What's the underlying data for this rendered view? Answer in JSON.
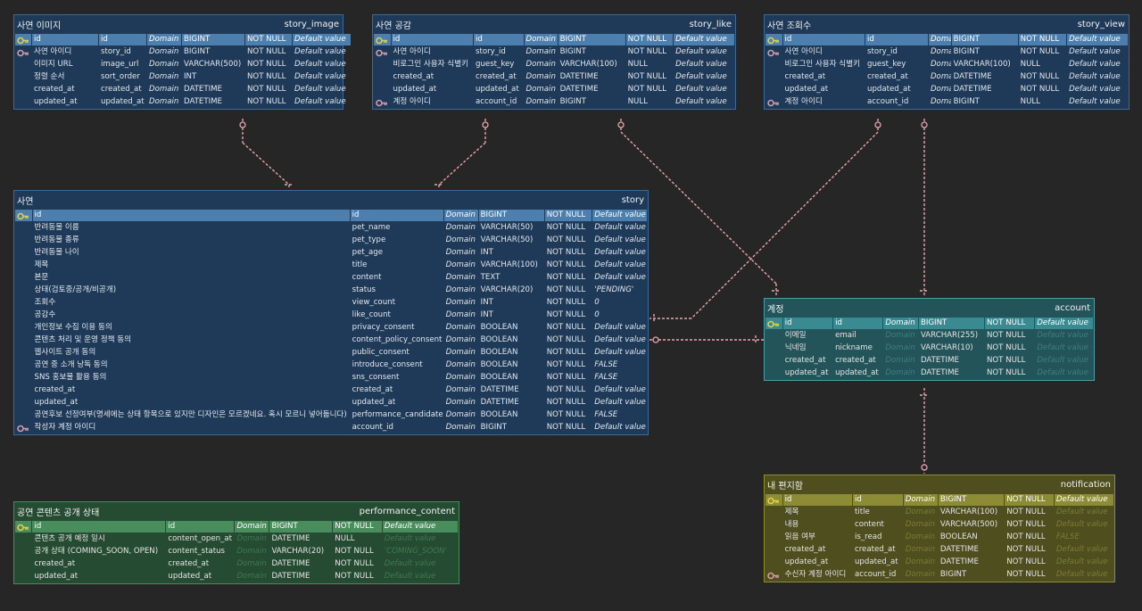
{
  "colors": {
    "background": "#262626",
    "blue_entity": "#1e3a58",
    "blue_header": "#4c7fae",
    "teal_entity": "#22545a",
    "teal_header": "#3a8a91",
    "green_entity": "#254b32",
    "green_header": "#4a8d5c",
    "olive_entity": "#4e4e1e",
    "olive_header": "#8c8c36",
    "relationship_line": "#e7a3ac",
    "primary_key_icon": "#e0d048",
    "foreign_key_icon": "#d49aa6"
  },
  "entities": {
    "story_image": {
      "logical_name": "사연 이미지",
      "physical_name": "story_image",
      "columns": [
        {
          "logical": "id",
          "physical": "id",
          "domain": "Domain",
          "type": "BIGINT",
          "nullable": "NOT NULL",
          "default": "Default value",
          "key": "pk"
        },
        {
          "logical": "사연 아이디",
          "physical": "story_id",
          "domain": "Domain",
          "type": "BIGINT",
          "nullable": "NOT NULL",
          "default": "Default value",
          "key": "fk"
        },
        {
          "logical": "이미지 URL",
          "physical": "image_url",
          "domain": "Domain",
          "type": "VARCHAR(500)",
          "nullable": "NOT NULL",
          "default": "Default value",
          "key": ""
        },
        {
          "logical": "정렬 순서",
          "physical": "sort_order",
          "domain": "Domain",
          "type": "INT",
          "nullable": "NOT NULL",
          "default": "Default value",
          "key": ""
        },
        {
          "logical": "created_at",
          "physical": "created_at",
          "domain": "Domain",
          "type": "DATETIME",
          "nullable": "NOT NULL",
          "default": "Default value",
          "key": ""
        },
        {
          "logical": "updated_at",
          "physical": "updated_at",
          "domain": "Domain",
          "type": "DATETIME",
          "nullable": "NOT NULL",
          "default": "Default value",
          "key": ""
        }
      ]
    },
    "story_like": {
      "logical_name": "사연 공감",
      "physical_name": "story_like",
      "columns": [
        {
          "logical": "id",
          "physical": "id",
          "domain": "Domain",
          "type": "BIGINT",
          "nullable": "NOT NULL",
          "default": "Default value",
          "key": "pk"
        },
        {
          "logical": "사연 아이디",
          "physical": "story_id",
          "domain": "Domain",
          "type": "BIGINT",
          "nullable": "NOT NULL",
          "default": "Default value",
          "key": "fk"
        },
        {
          "logical": "비로그인 사용자 식별키",
          "physical": "guest_key",
          "domain": "Domain",
          "type": "VARCHAR(100)",
          "nullable": "NULL",
          "default": "Default value",
          "key": ""
        },
        {
          "logical": "created_at",
          "physical": "created_at",
          "domain": "Domain",
          "type": "DATETIME",
          "nullable": "NOT NULL",
          "default": "Default value",
          "key": ""
        },
        {
          "logical": "updated_at",
          "physical": "updated_at",
          "domain": "Domain",
          "type": "DATETIME",
          "nullable": "NOT NULL",
          "default": "Default value",
          "key": ""
        },
        {
          "logical": "계정 아이디",
          "physical": "account_id",
          "domain": "Domain",
          "type": "BIGINT",
          "nullable": "NULL",
          "default": "Default value",
          "key": "fk"
        }
      ]
    },
    "story_view": {
      "logical_name": "사연 조회수",
      "physical_name": "story_view",
      "columns": [
        {
          "logical": "id",
          "physical": "id",
          "domain": "Domain",
          "type": "BIGINT",
          "nullable": "NOT NULL",
          "default": "Default value",
          "key": "pk"
        },
        {
          "logical": "사연 아이디",
          "physical": "story_id",
          "domain": "Domain",
          "type": "BIGINT",
          "nullable": "NOT NULL",
          "default": "Default value",
          "key": "fk"
        },
        {
          "logical": "비로그인 사용자 식별키",
          "physical": "guest_key",
          "domain": "Domain",
          "type": "VARCHAR(100)",
          "nullable": "NULL",
          "default": "Default value",
          "key": ""
        },
        {
          "logical": "created_at",
          "physical": "created_at",
          "domain": "Domain",
          "type": "DATETIME",
          "nullable": "NOT NULL",
          "default": "Default value",
          "key": ""
        },
        {
          "logical": "updated_at",
          "physical": "updated_at",
          "domain": "Domain",
          "type": "DATETIME",
          "nullable": "NOT NULL",
          "default": "Default value",
          "key": ""
        },
        {
          "logical": "계정 아이디",
          "physical": "account_id",
          "domain": "Domain",
          "type": "BIGINT",
          "nullable": "NULL",
          "default": "Default value",
          "key": "fk"
        }
      ]
    },
    "story": {
      "logical_name": "사연",
      "physical_name": "story",
      "columns": [
        {
          "logical": "id",
          "physical": "id",
          "domain": "Domain",
          "type": "BIGINT",
          "nullable": "NOT NULL",
          "default": "Default value",
          "key": "pk"
        },
        {
          "logical": "반려동물 이름",
          "physical": "pet_name",
          "domain": "Domain",
          "type": "VARCHAR(50)",
          "nullable": "NOT NULL",
          "default": "Default value",
          "key": ""
        },
        {
          "logical": "반려동물 종류",
          "physical": "pet_type",
          "domain": "Domain",
          "type": "VARCHAR(50)",
          "nullable": "NOT NULL",
          "default": "Default value",
          "key": ""
        },
        {
          "logical": "반려동물 나이",
          "physical": "pet_age",
          "domain": "Domain",
          "type": "INT",
          "nullable": "NOT NULL",
          "default": "Default value",
          "key": ""
        },
        {
          "logical": "제목",
          "physical": "title",
          "domain": "Domain",
          "type": "VARCHAR(100)",
          "nullable": "NOT NULL",
          "default": "Default value",
          "key": ""
        },
        {
          "logical": "본문",
          "physical": "content",
          "domain": "Domain",
          "type": "TEXT",
          "nullable": "NOT NULL",
          "default": "Default value",
          "key": ""
        },
        {
          "logical": "상태(검토중/공개/비공개)",
          "physical": "status",
          "domain": "Domain",
          "type": "VARCHAR(20)",
          "nullable": "NOT NULL",
          "default": "'PENDING'",
          "key": ""
        },
        {
          "logical": "조회수",
          "physical": "view_count",
          "domain": "Domain",
          "type": "INT",
          "nullable": "NOT NULL",
          "default": "0",
          "key": ""
        },
        {
          "logical": "공감수",
          "physical": "like_count",
          "domain": "Domain",
          "type": "INT",
          "nullable": "NOT NULL",
          "default": "0",
          "key": ""
        },
        {
          "logical": "개인정보 수집 이용 동의",
          "physical": "privacy_consent",
          "domain": "Domain",
          "type": "BOOLEAN",
          "nullable": "NOT NULL",
          "default": "Default value",
          "key": ""
        },
        {
          "logical": "콘텐츠 처리 및 운영 정책 동의",
          "physical": "content_policy_consent",
          "domain": "Domain",
          "type": "BOOLEAN",
          "nullable": "NOT NULL",
          "default": "Default value",
          "key": ""
        },
        {
          "logical": "웹사이트 공개 동의",
          "physical": "public_consent",
          "domain": "Domain",
          "type": "BOOLEAN",
          "nullable": "NOT NULL",
          "default": "Default value",
          "key": ""
        },
        {
          "logical": "공연 중 소개 낭독 동의",
          "physical": "introduce_consent",
          "domain": "Domain",
          "type": "BOOLEAN",
          "nullable": "NOT NULL",
          "default": "FALSE",
          "key": ""
        },
        {
          "logical": "SNS 홍보물 활용 동의",
          "physical": "sns_consent",
          "domain": "Domain",
          "type": "BOOLEAN",
          "nullable": "NOT NULL",
          "default": "FALSE",
          "key": ""
        },
        {
          "logical": "created_at",
          "physical": "created_at",
          "domain": "Domain",
          "type": "DATETIME",
          "nullable": "NOT NULL",
          "default": "Default value",
          "key": ""
        },
        {
          "logical": "updated_at",
          "physical": "updated_at",
          "domain": "Domain",
          "type": "DATETIME",
          "nullable": "NOT NULL",
          "default": "Default value",
          "key": ""
        },
        {
          "logical": "공연후보 선정여부(명세에는 상태 항목으로 있지만 디자인은 모르겠네요. 혹시 모르니 넣어둡니다)",
          "physical": "performance_candidate",
          "domain": "Domain",
          "type": "BOOLEAN",
          "nullable": "NOT NULL",
          "default": "FALSE",
          "key": ""
        },
        {
          "logical": "작성자 계정 아이디",
          "physical": "account_id",
          "domain": "Domain",
          "type": "BIGINT",
          "nullable": "NOT NULL",
          "default": "Default value",
          "key": "fk"
        }
      ]
    },
    "account": {
      "logical_name": "계정",
      "physical_name": "account",
      "columns": [
        {
          "logical": "id",
          "physical": "id",
          "domain": "Domain",
          "type": "BIGINT",
          "nullable": "NOT NULL",
          "default": "Default value",
          "key": "pk"
        },
        {
          "logical": "이메일",
          "physical": "email",
          "domain": "Domain",
          "type": "VARCHAR(255)",
          "nullable": "NOT NULL",
          "default": "Default value",
          "key": ""
        },
        {
          "logical": "닉네임",
          "physical": "nickname",
          "domain": "Domain",
          "type": "VARCHAR(10)",
          "nullable": "NOT NULL",
          "default": "Default value",
          "key": ""
        },
        {
          "logical": "created_at",
          "physical": "created_at",
          "domain": "Domain",
          "type": "DATETIME",
          "nullable": "NOT NULL",
          "default": "Default value",
          "key": ""
        },
        {
          "logical": "updated_at",
          "physical": "updated_at",
          "domain": "Domain",
          "type": "DATETIME",
          "nullable": "NOT NULL",
          "default": "Default value",
          "key": ""
        }
      ]
    },
    "performance_content": {
      "logical_name": "공연 콘텐츠 공개 상태",
      "physical_name": "performance_content",
      "columns": [
        {
          "logical": "id",
          "physical": "id",
          "domain": "Domain",
          "type": "BIGINT",
          "nullable": "NOT NULL",
          "default": "Default value",
          "key": "pk"
        },
        {
          "logical": "콘텐츠 공개 예정 일시",
          "physical": "content_open_at",
          "domain": "Domain",
          "type": "DATETIME",
          "nullable": "NULL",
          "default": "Default value",
          "key": ""
        },
        {
          "logical": "공개 상태 (COMING_SOON, OPEN)",
          "physical": "content_status",
          "domain": "Domain",
          "type": "VARCHAR(20)",
          "nullable": "NOT NULL",
          "default": "'COMING_SOON'",
          "key": ""
        },
        {
          "logical": "created_at",
          "physical": "created_at",
          "domain": "Domain",
          "type": "DATETIME",
          "nullable": "NOT NULL",
          "default": "Default value",
          "key": ""
        },
        {
          "logical": "updated_at",
          "physical": "updated_at",
          "domain": "Domain",
          "type": "DATETIME",
          "nullable": "NOT NULL",
          "default": "Default value",
          "key": ""
        }
      ]
    },
    "notification": {
      "logical_name": "내 편지함",
      "physical_name": "notification",
      "columns": [
        {
          "logical": "id",
          "physical": "id",
          "domain": "Domain",
          "type": "BIGINT",
          "nullable": "NOT NULL",
          "default": "Default value",
          "key": "pk"
        },
        {
          "logical": "제목",
          "physical": "title",
          "domain": "Domain",
          "type": "VARCHAR(100)",
          "nullable": "NOT NULL",
          "default": "Default value",
          "key": ""
        },
        {
          "logical": "내용",
          "physical": "content",
          "domain": "Domain",
          "type": "VARCHAR(500)",
          "nullable": "NOT NULL",
          "default": "Default value",
          "key": ""
        },
        {
          "logical": "읽음 여부",
          "physical": "is_read",
          "domain": "Domain",
          "type": "BOOLEAN",
          "nullable": "NOT NULL",
          "default": "FALSE",
          "key": ""
        },
        {
          "logical": "created_at",
          "physical": "created_at",
          "domain": "Domain",
          "type": "DATETIME",
          "nullable": "NOT NULL",
          "default": "Default value",
          "key": ""
        },
        {
          "logical": "updated_at",
          "physical": "updated_at",
          "domain": "Domain",
          "type": "DATETIME",
          "nullable": "NOT NULL",
          "default": "Default value",
          "key": ""
        },
        {
          "logical": "수신자 계정 아이디",
          "physical": "account_id",
          "domain": "Domain",
          "type": "BIGINT",
          "nullable": "NOT NULL",
          "default": "Default value",
          "key": "fk"
        }
      ]
    }
  }
}
